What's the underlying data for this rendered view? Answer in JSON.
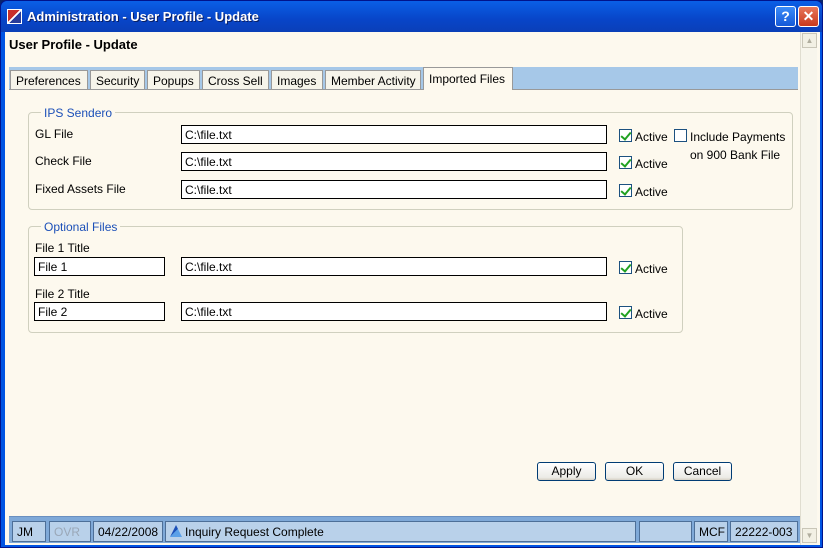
{
  "window": {
    "title": "Administration - User Profile - Update",
    "help_glyph": "?",
    "close_glyph": "✕"
  },
  "page_title": "User Profile - Update",
  "tabs": [
    {
      "label": "Preferences",
      "active": false
    },
    {
      "label": "Security",
      "active": false
    },
    {
      "label": "Popups",
      "active": false
    },
    {
      "label": "Cross Sell",
      "active": false
    },
    {
      "label": "Images",
      "active": false
    },
    {
      "label": "Member Activity",
      "active": false
    },
    {
      "label": "Imported Files",
      "active": true
    }
  ],
  "ips_sendero": {
    "legend": "IPS Sendero",
    "rows": [
      {
        "label": "GL File",
        "value": "C:\\file.txt",
        "active_label": "Active",
        "active": true
      },
      {
        "label": "Check File",
        "value": "C:\\file.txt",
        "active_label": "Active",
        "active": true
      },
      {
        "label": "Fixed Assets File",
        "value": "C:\\file.txt",
        "active_label": "Active",
        "active": true
      }
    ],
    "include_payments": {
      "line1": "Include Payments",
      "line2": "on 900 Bank File",
      "checked": false
    }
  },
  "optional_files": {
    "legend": "Optional Files",
    "rows": [
      {
        "title_label": "File 1 Title",
        "title_value": "File 1",
        "value": "C:\\file.txt",
        "active_label": "Active",
        "active": true
      },
      {
        "title_label": "File 2 Title",
        "title_value": "File 2",
        "value": "C:\\file.txt",
        "active_label": "Active",
        "active": true
      }
    ]
  },
  "buttons": {
    "apply": "Apply",
    "ok": "OK",
    "cancel": "Cancel"
  },
  "statusbar": {
    "user": "JM",
    "ovr": "OVR",
    "date": "04/22/2008",
    "message": "Inquiry Request Complete",
    "blank": "",
    "code": "MCF",
    "account": "22222-003"
  },
  "colors": {
    "accent": "#0054e3",
    "tab_bg": "#a6c8e8",
    "legend": "#1c50b8",
    "check": "#21a121"
  }
}
